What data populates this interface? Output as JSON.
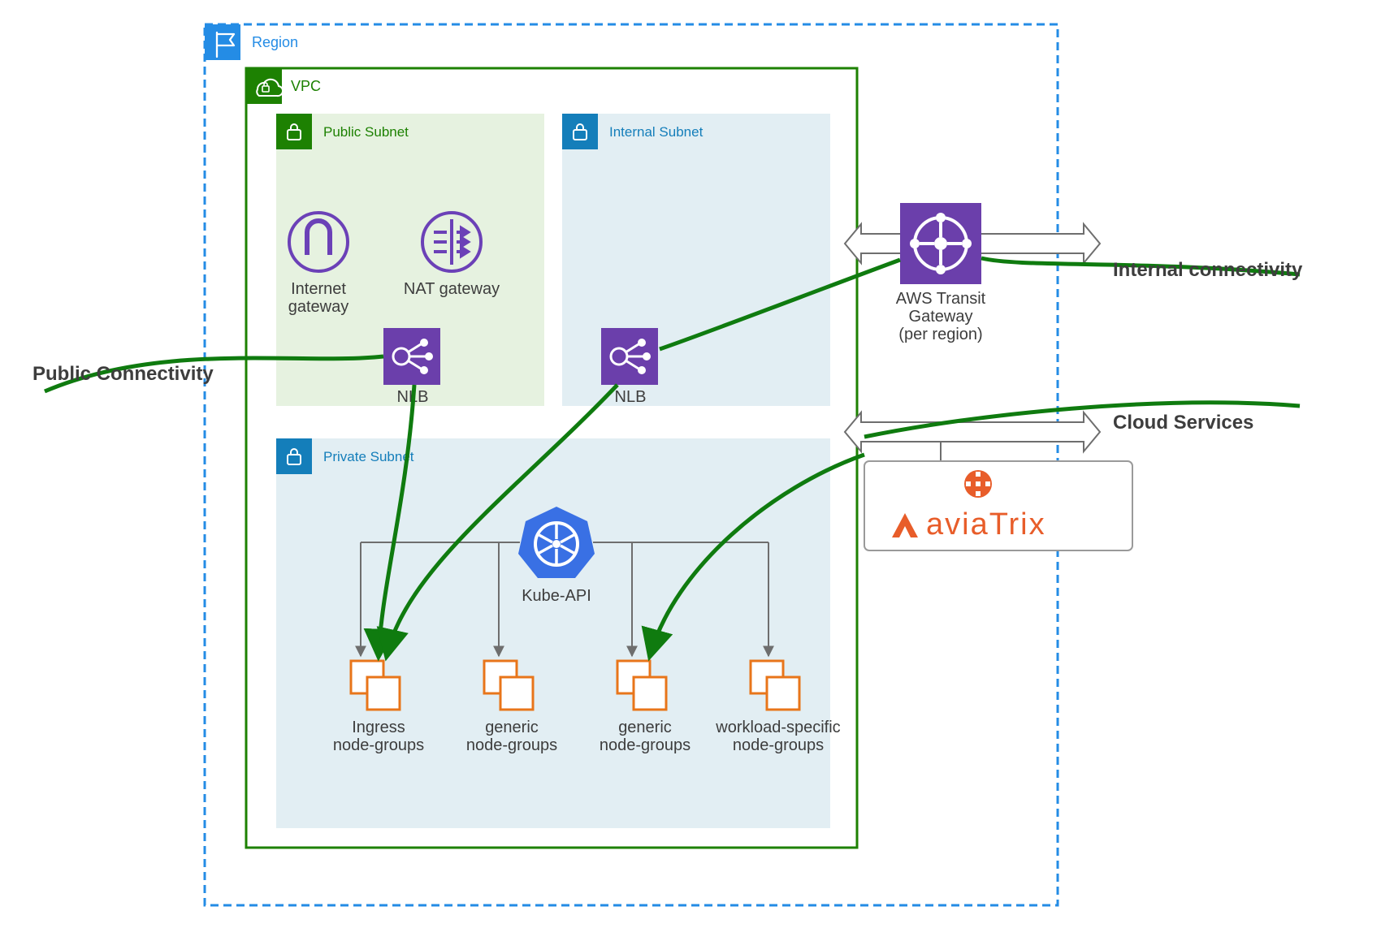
{
  "region_label": "Region",
  "vpc_label": "VPC",
  "public_subnet_label": "Public Subnet",
  "internal_subnet_label": "Internal Subnet",
  "private_subnet_label": "Private Subnet",
  "internet_gateway_line1": "Internet",
  "internet_gateway_line2": "gateway",
  "nat_gateway_label": "NAT gateway",
  "nlb_label": "NLB",
  "transit_gateway_line1": "AWS Transit",
  "transit_gateway_line2": "Gateway",
  "transit_gateway_line3": "(per region)",
  "kube_api_label": "Kube-API",
  "nodegroup1_line1": "Ingress",
  "nodegroup1_line2": "node-groups",
  "nodegroup2_line1": "generic",
  "nodegroup2_line2": "node-groups",
  "nodegroup3_line1": "generic",
  "nodegroup3_line2": "node-groups",
  "nodegroup4_line1": "workload-specific",
  "nodegroup4_line2": "node-groups",
  "public_connectivity_label": "Public Connectivity",
  "internal_connectivity_label": "Internal connectivity",
  "cloud_services_label": "Cloud Services",
  "aviatrix_label": "aviaTrix",
  "colors": {
    "region_border": "#248ce5",
    "region_fill_icon": "#248ce5",
    "vpc_green": "#1d8102",
    "subnet_green_fill": "#e6f2e0",
    "subnet_blue_fill": "#e2eef3",
    "subnet_blue_border": "#147eba",
    "purple": "#6b41b7",
    "purple_fill": "#6b3fab",
    "orange": "#e8751a",
    "gray_text": "#3d3d3d",
    "k8s_blue": "#3970e4",
    "dark_green_flow": "#0f7b0f",
    "aviatrix_orange": "#e85d2a"
  }
}
